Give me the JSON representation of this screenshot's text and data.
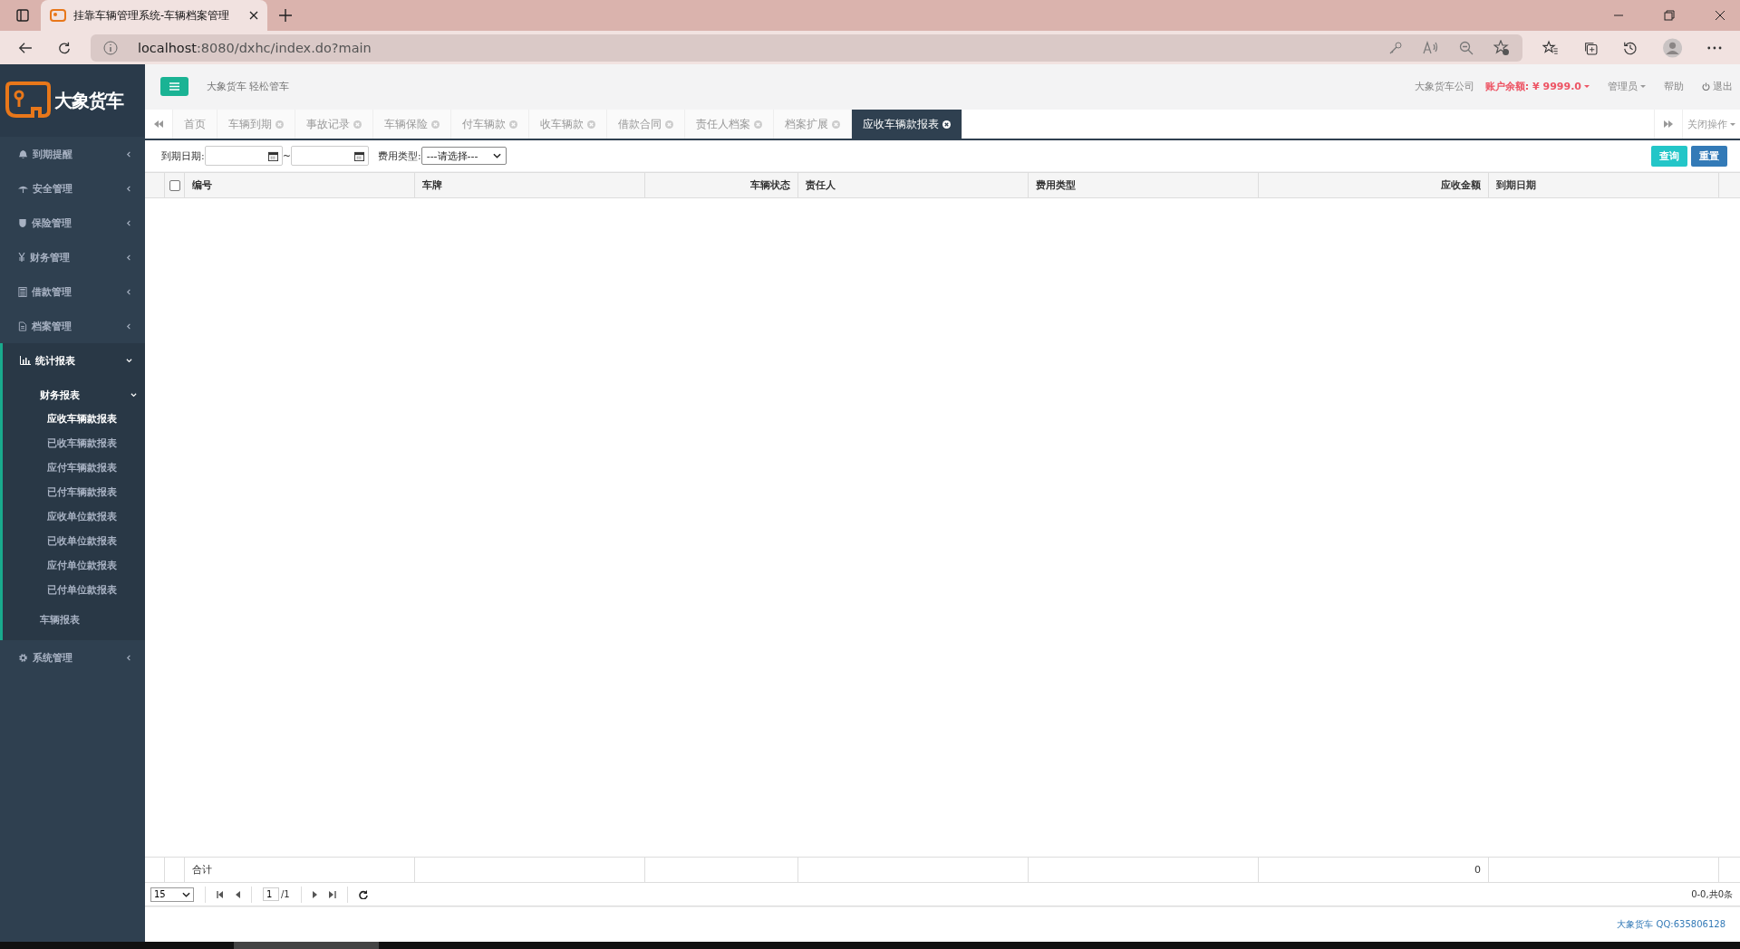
{
  "browser": {
    "tab_title": "挂靠车辆管理系统-车辆档案管理",
    "url_host": "localhost",
    "url_rest": ":8080/dxhc/index.do?main"
  },
  "logo": {
    "text": "大象货车"
  },
  "header": {
    "slogan": "大象货车 轻松管车",
    "company": "大象货车公司",
    "balance": "账户余额: ¥ 9999.0",
    "user": "管理员",
    "help": "帮助",
    "logout": "退出"
  },
  "sidebar": {
    "items": [
      {
        "label": "到期提醒",
        "expanded": false
      },
      {
        "label": "安全管理",
        "expanded": false
      },
      {
        "label": "保险管理",
        "expanded": false
      },
      {
        "label": "财务管理",
        "expanded": false
      },
      {
        "label": "借款管理",
        "expanded": false
      },
      {
        "label": "档案管理",
        "expanded": false
      },
      {
        "label": "统计报表",
        "expanded": true,
        "children": [
          {
            "label": "财务报表",
            "expanded": true,
            "children": [
              {
                "label": "应收车辆款报表",
                "selected": true
              },
              {
                "label": "已收车辆款报表",
                "selected": false
              },
              {
                "label": "应付车辆款报表",
                "selected": false
              },
              {
                "label": "已付车辆款报表",
                "selected": false
              },
              {
                "label": "应收单位款报表",
                "selected": false
              },
              {
                "label": "已收单位款报表",
                "selected": false
              },
              {
                "label": "应付单位款报表",
                "selected": false
              },
              {
                "label": "已付单位款报表",
                "selected": false
              }
            ]
          },
          {
            "label": "车辆报表",
            "expanded": false
          }
        ]
      },
      {
        "label": "系统管理",
        "expanded": false
      }
    ]
  },
  "tabs": [
    {
      "label": "首页",
      "closable": false,
      "selected": false
    },
    {
      "label": "车辆到期",
      "closable": true,
      "selected": false
    },
    {
      "label": "事故记录",
      "closable": true,
      "selected": false
    },
    {
      "label": "车辆保险",
      "closable": true,
      "selected": false
    },
    {
      "label": "付车辆款",
      "closable": true,
      "selected": false
    },
    {
      "label": "收车辆款",
      "closable": true,
      "selected": false
    },
    {
      "label": "借款合同",
      "closable": true,
      "selected": false
    },
    {
      "label": "责任人档案",
      "closable": true,
      "selected": false
    },
    {
      "label": "档案扩展",
      "closable": true,
      "selected": false
    },
    {
      "label": "应收车辆款报表",
      "closable": true,
      "selected": true
    }
  ],
  "tab_menu": "关闭操作",
  "filters": {
    "date_label": "到期日期:",
    "date_sep": "~",
    "type_label": "费用类型:",
    "type_placeholder": "---请选择---",
    "buttons": [
      {
        "label": "查询",
        "kind": "query"
      },
      {
        "label": "重置",
        "kind": "reset"
      }
    ]
  },
  "table": {
    "select_all_checked": false,
    "columns": [
      {
        "label": "编号"
      },
      {
        "label": "车牌"
      },
      {
        "label": "车辆状态"
      },
      {
        "label": "责任人"
      },
      {
        "label": "费用类型"
      },
      {
        "label": "应收金额"
      },
      {
        "label": "到期日期"
      }
    ],
    "footer": {
      "label": "合计",
      "amount": "0"
    }
  },
  "pager": {
    "page_size": "15",
    "page": "1",
    "total": "/1",
    "summary": "0-0,共0条"
  },
  "footer": "大象货车 QQ:635806128"
}
